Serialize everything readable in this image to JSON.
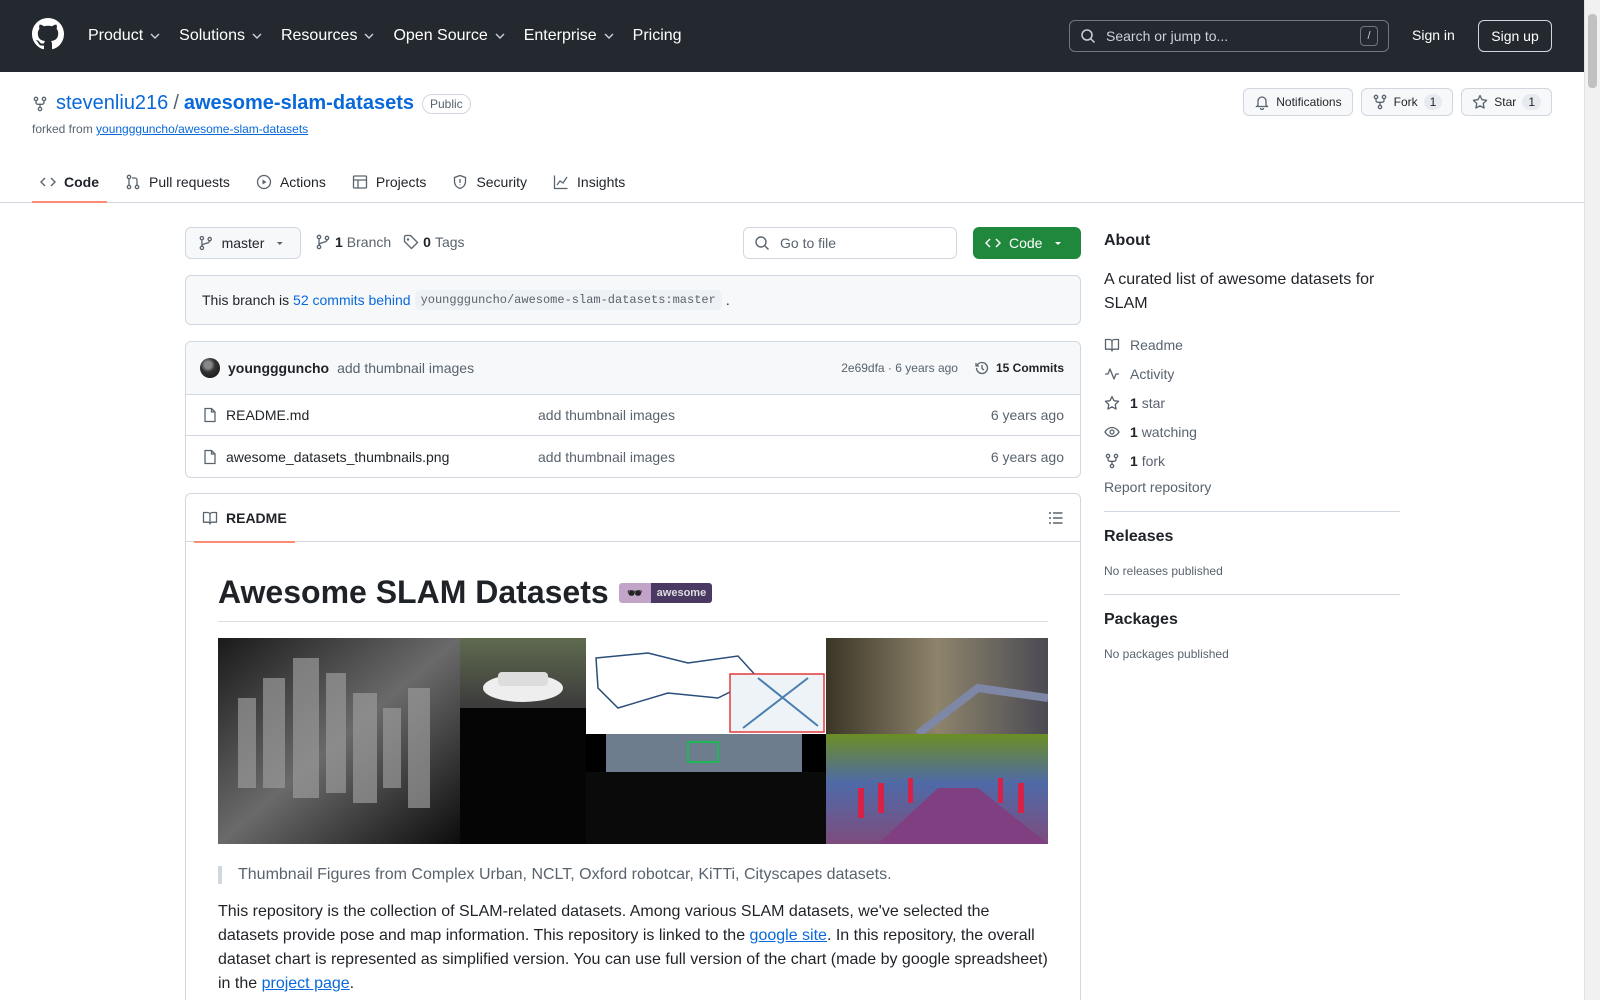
{
  "header": {
    "nav": [
      {
        "label": "Product",
        "dropdown": true
      },
      {
        "label": "Solutions",
        "dropdown": true
      },
      {
        "label": "Resources",
        "dropdown": true
      },
      {
        "label": "Open Source",
        "dropdown": true
      },
      {
        "label": "Enterprise",
        "dropdown": true
      },
      {
        "label": "Pricing",
        "dropdown": false
      }
    ],
    "search_placeholder": "Search or jump to...",
    "search_shortcut": "/",
    "signin": "Sign in",
    "signup": "Sign up"
  },
  "repo": {
    "owner": "stevenliu216",
    "separator": "/",
    "name": "awesome-slam-datasets",
    "visibility": "Public",
    "forked_prefix": "forked from",
    "forked_from": "younggguncho/awesome-slam-datasets",
    "notifications_label": "Notifications",
    "fork_label": "Fork",
    "fork_count": "1",
    "star_label": "Star",
    "star_count": "1"
  },
  "tabs": [
    {
      "label": "Code",
      "icon": "code-icon",
      "active": true
    },
    {
      "label": "Pull requests",
      "icon": "pull-request-icon",
      "active": false
    },
    {
      "label": "Actions",
      "icon": "play-icon",
      "active": false
    },
    {
      "label": "Projects",
      "icon": "table-icon",
      "active": false
    },
    {
      "label": "Security",
      "icon": "shield-icon",
      "active": false
    },
    {
      "label": "Insights",
      "icon": "graph-icon",
      "active": false
    }
  ],
  "filebar": {
    "branch": "master",
    "branch_count": "1",
    "branch_label": "Branch",
    "tag_count": "0",
    "tag_label": "Tags",
    "goto_placeholder": "Go to file",
    "code_button": "Code"
  },
  "behind": {
    "prefix": "This branch is",
    "link": "52 commits behind",
    "ref": "younggguncho/awesome-slam-datasets:master",
    "suffix": "."
  },
  "latest_commit": {
    "author": "younggguncho",
    "message": "add thumbnail images",
    "meta": "2e69dfa · 6 years ago",
    "commits": "15 Commits"
  },
  "files": [
    {
      "name": "README.md",
      "message": "add thumbnail images",
      "time": "6 years ago"
    },
    {
      "name": "awesome_datasets_thumbnails.png",
      "message": "add thumbnail images",
      "time": "6 years ago"
    }
  ],
  "readme": {
    "tab_label": "README",
    "title": "Awesome SLAM Datasets",
    "badge": "awesome",
    "quote": "Thumbnail Figures from Complex Urban, NCLT, Oxford robotcar, KiTTi, Cityscapes datasets.",
    "para_1": "This repository is the collection of SLAM-related datasets. Among various SLAM datasets, we've selected the datasets provide pose and map information. This repository is linked to the ",
    "link_1": "google site",
    "para_2": ". In this repository, the overall dataset chart is represented as simplified version. You can use full version of the chart (made by google spreadsheet) in the ",
    "link_2": "project page",
    "para_3": "."
  },
  "about": {
    "title": "About",
    "description": "A curated list of awesome datasets for SLAM",
    "readme": "Readme",
    "activity": "Activity",
    "stars_count": "1",
    "stars_label": "star",
    "watching_count": "1",
    "watching_label": "watching",
    "forks_count": "1",
    "forks_label": "fork",
    "report": "Report repository"
  },
  "releases": {
    "title": "Releases",
    "text": "No releases published"
  },
  "packages": {
    "title": "Packages",
    "text": "No packages published"
  },
  "colors": {
    "accent": "#0969da",
    "header_bg": "#24292f",
    "primary_button": "#1f883d",
    "tab_underline": "#fd8c73"
  }
}
